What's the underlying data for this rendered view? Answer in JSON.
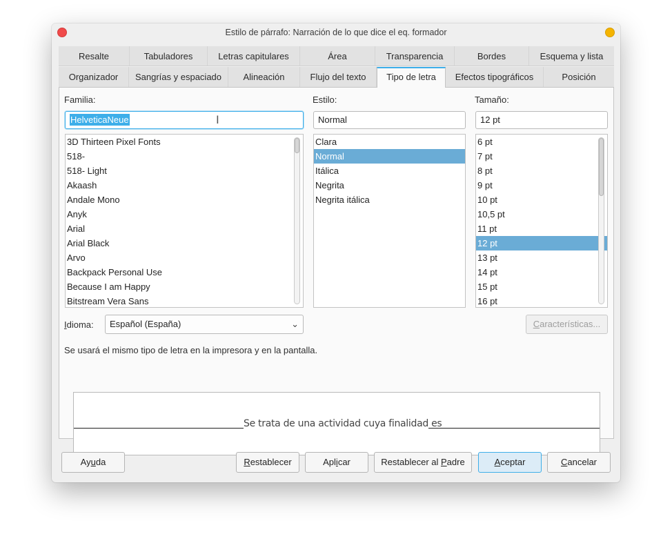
{
  "window": {
    "title": "Estilo de párrafo: Narración de lo que dice el eq. formador"
  },
  "tabs_row1": [
    "Resalte",
    "Tabuladores",
    "Letras capitulares",
    "Área",
    "Transparencia",
    "Bordes",
    "Esquema y lista"
  ],
  "tabs_row2": [
    "Organizador",
    "Sangrías y espaciado",
    "Alineación",
    "Flujo del texto",
    "Tipo de letra",
    "Efectos tipográficos",
    "Posición"
  ],
  "active_tab": "Tipo de letra",
  "family": {
    "label": "Familia:",
    "value": "HelveticaNeue",
    "items": [
      "3D Thirteen Pixel Fonts",
      "518-",
      "518- Light",
      "Akaash",
      "Andale Mono",
      "Anyk",
      "Arial",
      "Arial Black",
      "Arvo",
      "Backpack Personal Use",
      "Because I am Happy",
      "Bitstream Vera Sans"
    ]
  },
  "style": {
    "label": "Estilo:",
    "value": "Normal",
    "items": [
      "Clara",
      "Normal",
      "Itálica",
      "Negrita",
      "Negrita itálica"
    ],
    "selected": "Normal"
  },
  "size": {
    "label": "Tamaño:",
    "value": "12 pt",
    "items": [
      "6 pt",
      "7 pt",
      "8 pt",
      "9 pt",
      "10 pt",
      "10,5 pt",
      "11 pt",
      "12 pt",
      "13 pt",
      "14 pt",
      "15 pt",
      "16 pt"
    ],
    "selected": "12 pt"
  },
  "language": {
    "label_prefix": "I",
    "label_rest": "dioma:",
    "value": "Español (España)"
  },
  "features_button": "Características...",
  "info_text": "Se usará el mismo tipo de letra en la impresora y en la pantalla.",
  "preview_text": "Se trata de una actividad cuya finalidad es",
  "buttons": {
    "help": "Ayuda",
    "reset": "Restablecer",
    "apply": "Aplicar",
    "reset_parent": "Restablecer al Padre",
    "ok": "Aceptar",
    "cancel": "Cancelar"
  },
  "colors": {
    "accent": "#3daee9",
    "selection": "#6aacd6",
    "close": "#f04a4a",
    "minimize": "#f5b400"
  }
}
